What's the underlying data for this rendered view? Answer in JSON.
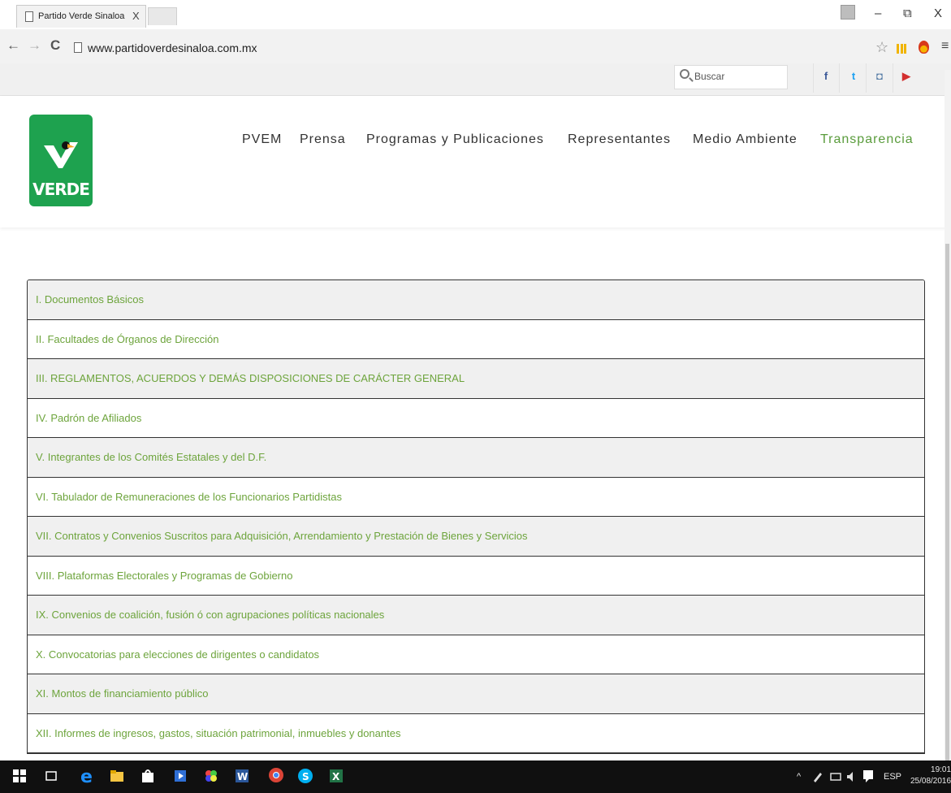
{
  "browser": {
    "tab_title": "Partido Verde Sinaloa",
    "tab_close": "X",
    "url": "www.partidoverdesinaloa.com.mx",
    "back_glyph": "←",
    "forward_glyph": "→",
    "reload_glyph": "C",
    "star_glyph": "☆",
    "menu_glyph": "≡",
    "minimize_glyph": "–",
    "restore_glyph": "⧉",
    "close_glyph": "X"
  },
  "topbar": {
    "search_placeholder": "Buscar",
    "social": [
      {
        "name": "facebook-icon",
        "glyph": "f",
        "color": "#3b5998"
      },
      {
        "name": "twitter-icon",
        "glyph": "t",
        "color": "#1da1f2"
      },
      {
        "name": "instagram-icon",
        "glyph": "◘",
        "color": "#5a7fa8"
      },
      {
        "name": "youtube-icon",
        "glyph": "▶",
        "color": "#d32f2f"
      }
    ]
  },
  "logo": {
    "text": "VERDE",
    "color": "#1ea24f"
  },
  "nav": {
    "items": [
      "PVEM",
      "Prensa",
      "Programas y Publicaciones",
      "Representantes",
      "Medio Ambiente",
      "Transparencia"
    ],
    "active": "Transparencia",
    "active_color": "#5a9c3c"
  },
  "transparency": {
    "items": [
      "I. Documentos Básicos",
      "II. Facultades de Órganos de Dirección",
      "III. REGLAMENTOS, ACUERDOS Y DEMÁS DISPOSICIONES DE CARÁCTER GENERAL",
      "IV. Padrón de Afiliados",
      "V. Integrantes de los Comités Estatales y del D.F.",
      "VI. Tabulador de Remuneraciones de los Funcionarios Partidistas",
      "VII. Contratos y Convenios Suscritos para Adquisición, Arrendamiento y Prestación de Bienes y Servicios",
      "VIII. Plataformas Electorales y Programas de Gobierno",
      "IX. Convenios de coalición, fusión ó con agrupaciones políticas nacionales",
      "X. Convocatorias para elecciones de dirigentes o candidatos",
      "XI. Montos de financiamiento público",
      "XII. Informes de ingresos, gastos, situación patrimonial, inmuebles y donantes"
    ],
    "link_color": "#6da43c"
  },
  "taskbar": {
    "language": "ESP",
    "time": "19:01",
    "date": "25/08/2016",
    "tray_caret": "^"
  }
}
